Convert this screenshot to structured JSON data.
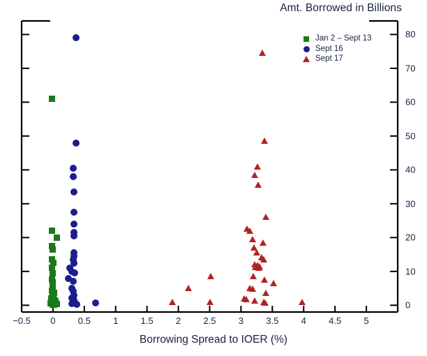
{
  "chart_data": {
    "type": "scatter",
    "title": "Amt. Borrowed in Billions",
    "xlabel": "Borrowing Spread to IOER (%)",
    "ylabel": "",
    "xlim": [
      -0.5,
      5.5
    ],
    "ylim": [
      -2,
      84
    ],
    "xticks": [
      -0.5,
      0,
      0.5,
      1,
      1.5,
      2,
      2.5,
      3,
      3.5,
      4,
      4.5,
      5
    ],
    "xticklabels": [
      "−0.5",
      "0",
      "0.5",
      "1",
      "1.5",
      "2",
      "2.5",
      "3",
      "3.5",
      "4",
      "4.5",
      "5"
    ],
    "yticks": [
      0,
      10,
      20,
      30,
      40,
      50,
      60,
      70,
      80
    ],
    "yticklabels": [
      "0",
      "10",
      "20",
      "30",
      "40",
      "50",
      "60",
      "70",
      "80"
    ],
    "grid": false,
    "legend_position": "top-right",
    "series": [
      {
        "name": "Jan 2 – Sept 13",
        "marker": "square",
        "color": "#1a7a1a",
        "points": [
          [
            -0.02,
            61.0
          ],
          [
            -0.02,
            22.0
          ],
          [
            0.06,
            20.0
          ],
          [
            -0.02,
            17.5
          ],
          [
            -0.01,
            16.5
          ],
          [
            -0.02,
            13.5
          ],
          [
            0.01,
            12.5
          ],
          [
            -0.02,
            11.0
          ],
          [
            0.0,
            9.5
          ],
          [
            -0.02,
            7.5
          ],
          [
            0.0,
            6.8
          ],
          [
            -0.01,
            6.0
          ],
          [
            0.0,
            5.2
          ],
          [
            -0.02,
            4.2
          ],
          [
            0.02,
            3.6
          ],
          [
            -0.01,
            3.0
          ],
          [
            0.01,
            2.4
          ],
          [
            -0.03,
            2.0
          ],
          [
            0.02,
            1.6
          ],
          [
            0.04,
            1.2
          ],
          [
            -0.02,
            1.0
          ],
          [
            0.0,
            0.8
          ],
          [
            0.03,
            0.6
          ],
          [
            -0.04,
            0.5
          ],
          [
            0.06,
            0.4
          ],
          [
            0.0,
            0.3
          ],
          [
            -0.01,
            0.2
          ],
          [
            0.02,
            0.1
          ]
        ]
      },
      {
        "name": "Sept 16",
        "marker": "circle",
        "color": "#1d1d8f",
        "points": [
          [
            0.37,
            79.0
          ],
          [
            0.37,
            48.0
          ],
          [
            0.32,
            40.5
          ],
          [
            0.32,
            38.0
          ],
          [
            0.33,
            33.5
          ],
          [
            0.33,
            27.5
          ],
          [
            0.33,
            24.0
          ],
          [
            0.33,
            21.5
          ],
          [
            0.33,
            20.5
          ],
          [
            0.33,
            15.5
          ],
          [
            0.33,
            14.5
          ],
          [
            0.32,
            13.5
          ],
          [
            0.33,
            12.5
          ],
          [
            0.27,
            11.0
          ],
          [
            0.3,
            10.0
          ],
          [
            0.35,
            9.5
          ],
          [
            0.25,
            8.0
          ],
          [
            0.32,
            7.0
          ],
          [
            0.3,
            5.0
          ],
          [
            0.32,
            4.2
          ],
          [
            0.33,
            3.0
          ],
          [
            0.3,
            2.2
          ],
          [
            0.34,
            1.6
          ],
          [
            0.32,
            1.0
          ],
          [
            0.35,
            0.6
          ],
          [
            0.3,
            0.4
          ],
          [
            0.38,
            0.3
          ],
          [
            0.68,
            0.6
          ]
        ]
      },
      {
        "name": "Sept 17",
        "marker": "triangle",
        "color": "#b32222",
        "points": [
          [
            3.34,
            74.5
          ],
          [
            3.37,
            48.5
          ],
          [
            3.26,
            41.0
          ],
          [
            3.22,
            38.5
          ],
          [
            3.27,
            35.5
          ],
          [
            3.4,
            26.0
          ],
          [
            3.1,
            22.5
          ],
          [
            3.14,
            22.0
          ],
          [
            3.19,
            19.5
          ],
          [
            3.35,
            18.5
          ],
          [
            3.21,
            17.0
          ],
          [
            3.25,
            15.5
          ],
          [
            3.33,
            14.0
          ],
          [
            3.36,
            13.5
          ],
          [
            3.22,
            12.0
          ],
          [
            3.26,
            11.8
          ],
          [
            3.3,
            11.5
          ],
          [
            3.23,
            11.2
          ],
          [
            3.28,
            11.0
          ],
          [
            3.2,
            8.5
          ],
          [
            2.52,
            8.5
          ],
          [
            3.37,
            7.5
          ],
          [
            3.52,
            6.5
          ],
          [
            3.14,
            5.0
          ],
          [
            3.18,
            4.8
          ],
          [
            2.16,
            5.0
          ],
          [
            3.4,
            3.5
          ],
          [
            3.05,
            2.0
          ],
          [
            3.08,
            1.8
          ],
          [
            3.22,
            1.2
          ],
          [
            3.36,
            0.8
          ],
          [
            3.38,
            0.6
          ],
          [
            1.9,
            0.9
          ],
          [
            2.5,
            0.8
          ],
          [
            3.98,
            0.9
          ]
        ]
      }
    ]
  }
}
